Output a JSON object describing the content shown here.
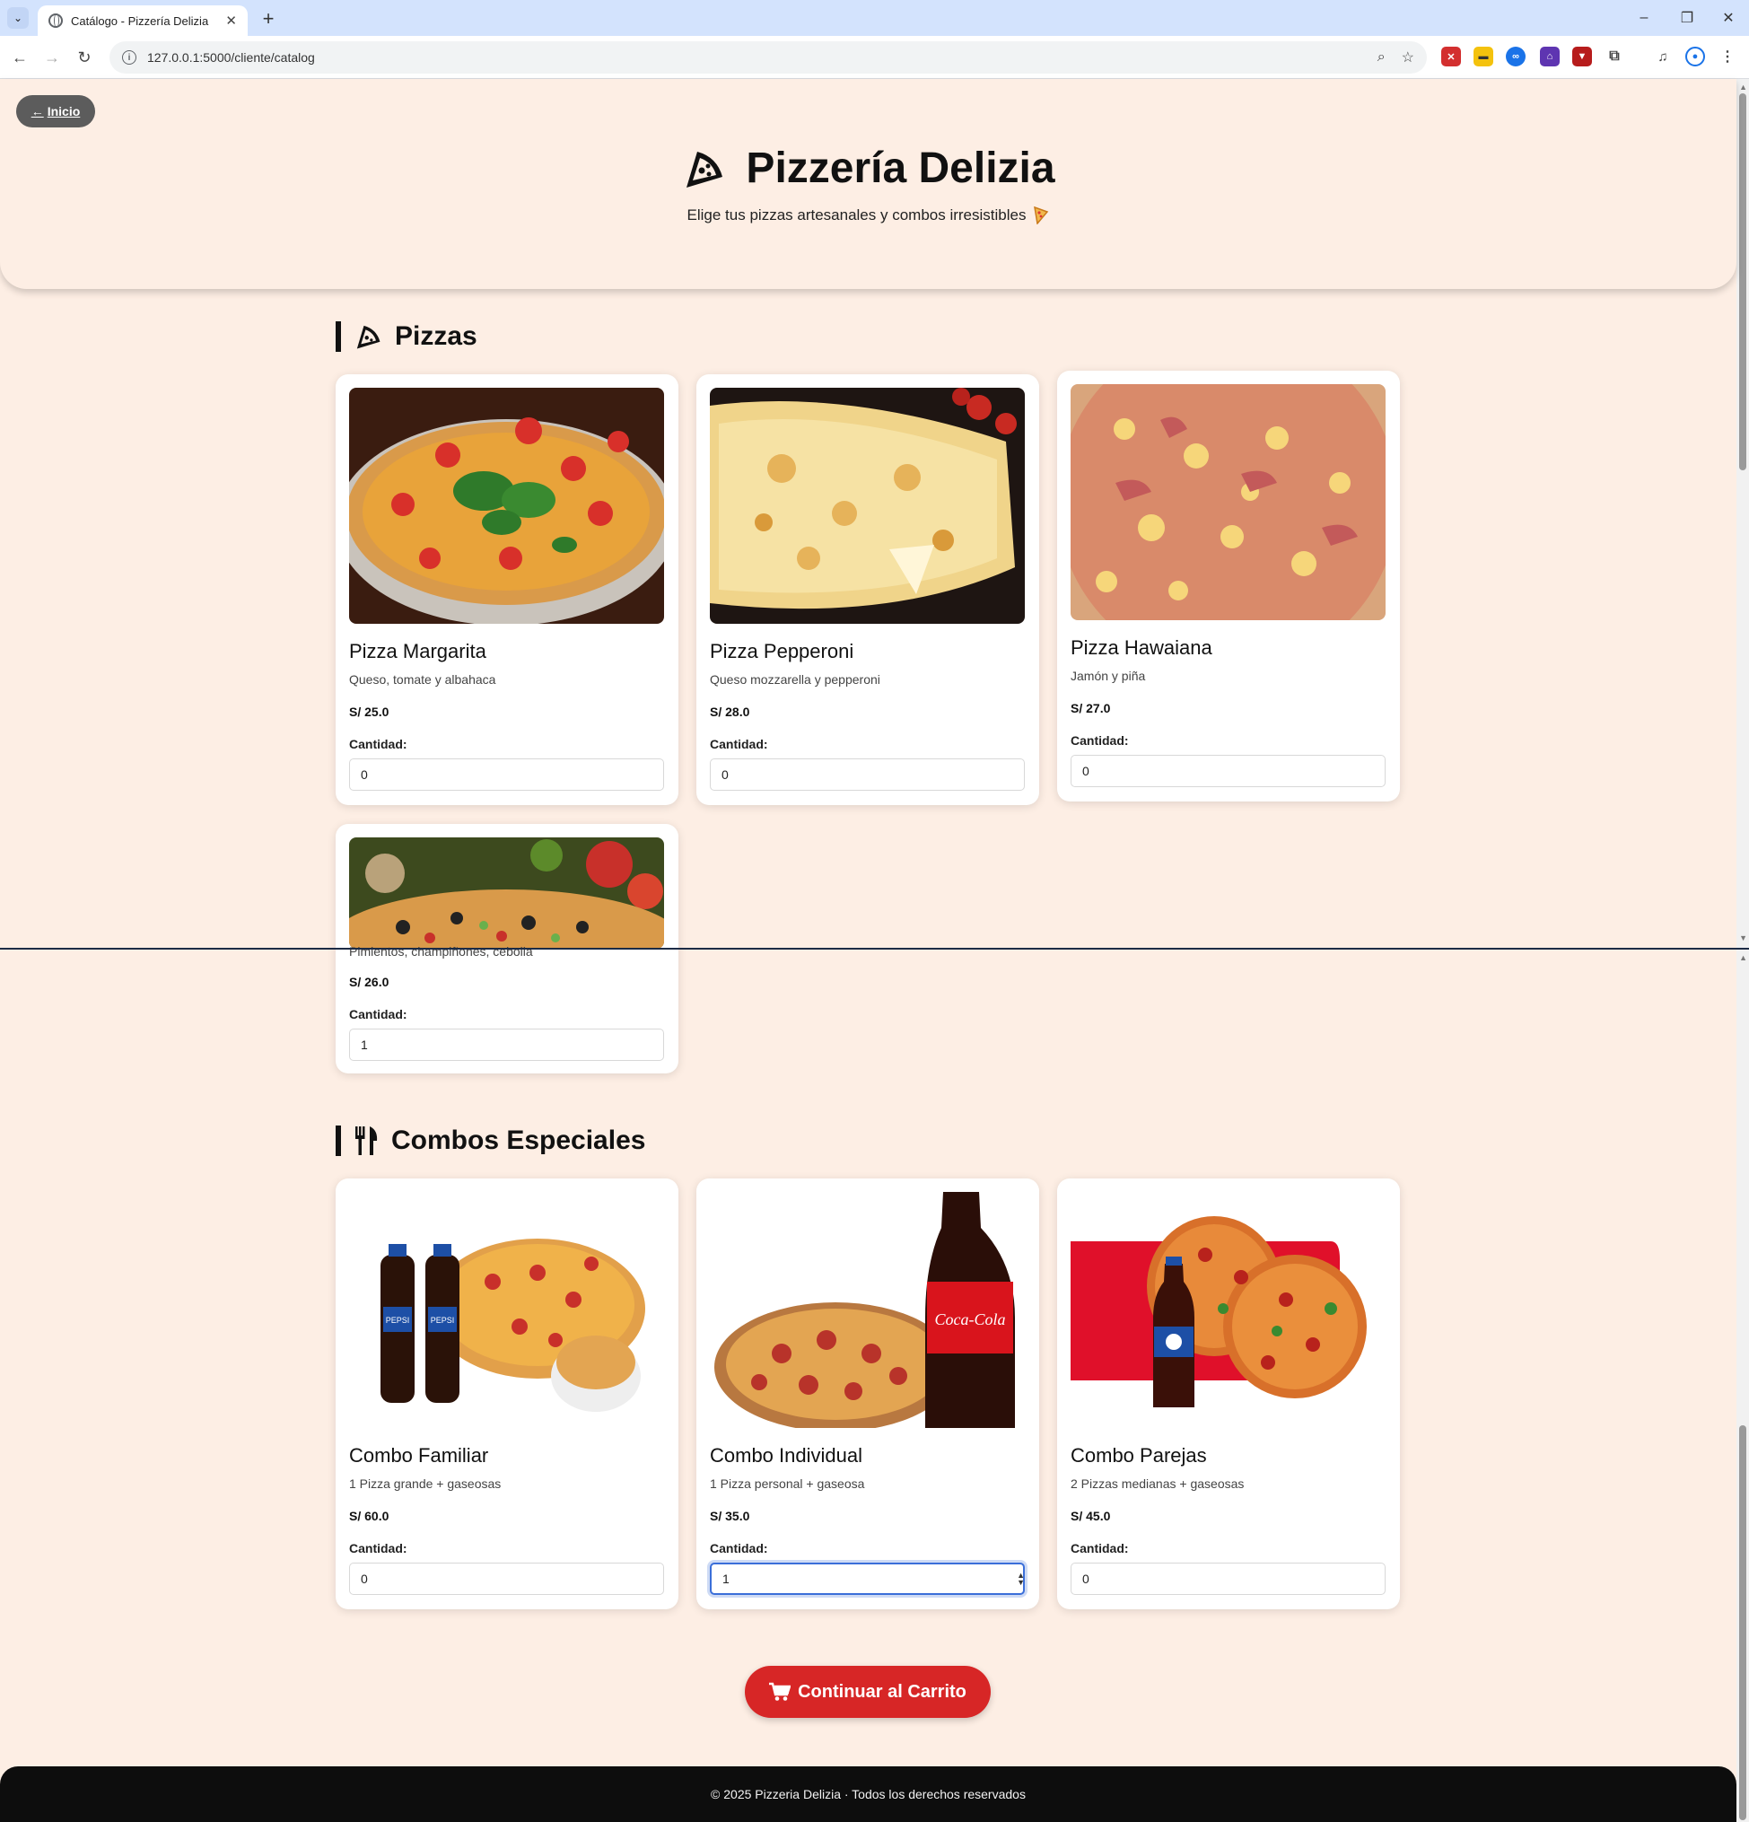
{
  "browser": {
    "tab_title": "Catálogo - Pizzería Delizia",
    "url": "127.0.0.1:5000/cliente/catalog"
  },
  "page": {
    "back_label": "Inicio",
    "title": "Pizzería Delizia",
    "subtitle": "Elige tus pizzas artesanales y combos irresistibles",
    "cart_button": "Continuar al Carrito",
    "footer": "© 2025 Pizzeria Delizia · Todos los derechos reservados"
  },
  "pizzas": {
    "heading": "Pizzas",
    "qty_label": "Cantidad:",
    "items": [
      {
        "name": "Pizza Margarita",
        "desc": "Queso, tomate y albahaca",
        "price": "S/ 25.0",
        "qty": "0"
      },
      {
        "name": "Pizza Pepperoni",
        "desc": "Queso mozzarella y pepperoni",
        "price": "S/ 28.0",
        "qty": "0"
      },
      {
        "name": "Pizza Hawaiana",
        "desc": "Jamón y piña",
        "price": "S/ 27.0",
        "qty": "0"
      },
      {
        "name": "",
        "desc": "Pimientos, champiñones, cebolla",
        "price": "S/ 26.0",
        "qty": "1"
      }
    ]
  },
  "combos": {
    "heading": "Combos Especiales",
    "qty_label": "Cantidad:",
    "items": [
      {
        "name": "Combo Familiar",
        "desc": "1 Pizza grande + gaseosas",
        "price": "S/ 60.0",
        "qty": "0"
      },
      {
        "name": "Combo Individual",
        "desc": "1 Pizza personal + gaseosa",
        "price": "S/ 35.0",
        "qty": "1"
      },
      {
        "name": "Combo Parejas",
        "desc": "2 Pizzas medianas + gaseosas",
        "price": "S/ 45.0",
        "qty": "0"
      }
    ]
  },
  "images": {
    "pepsi_label": "PEPSI",
    "cola_label": "Coca-Cola"
  },
  "colors": {
    "background": "#fdeee4",
    "accent_red": "#d72626",
    "footer": "#0d0d0d",
    "back_button": "#5c5c5c"
  }
}
